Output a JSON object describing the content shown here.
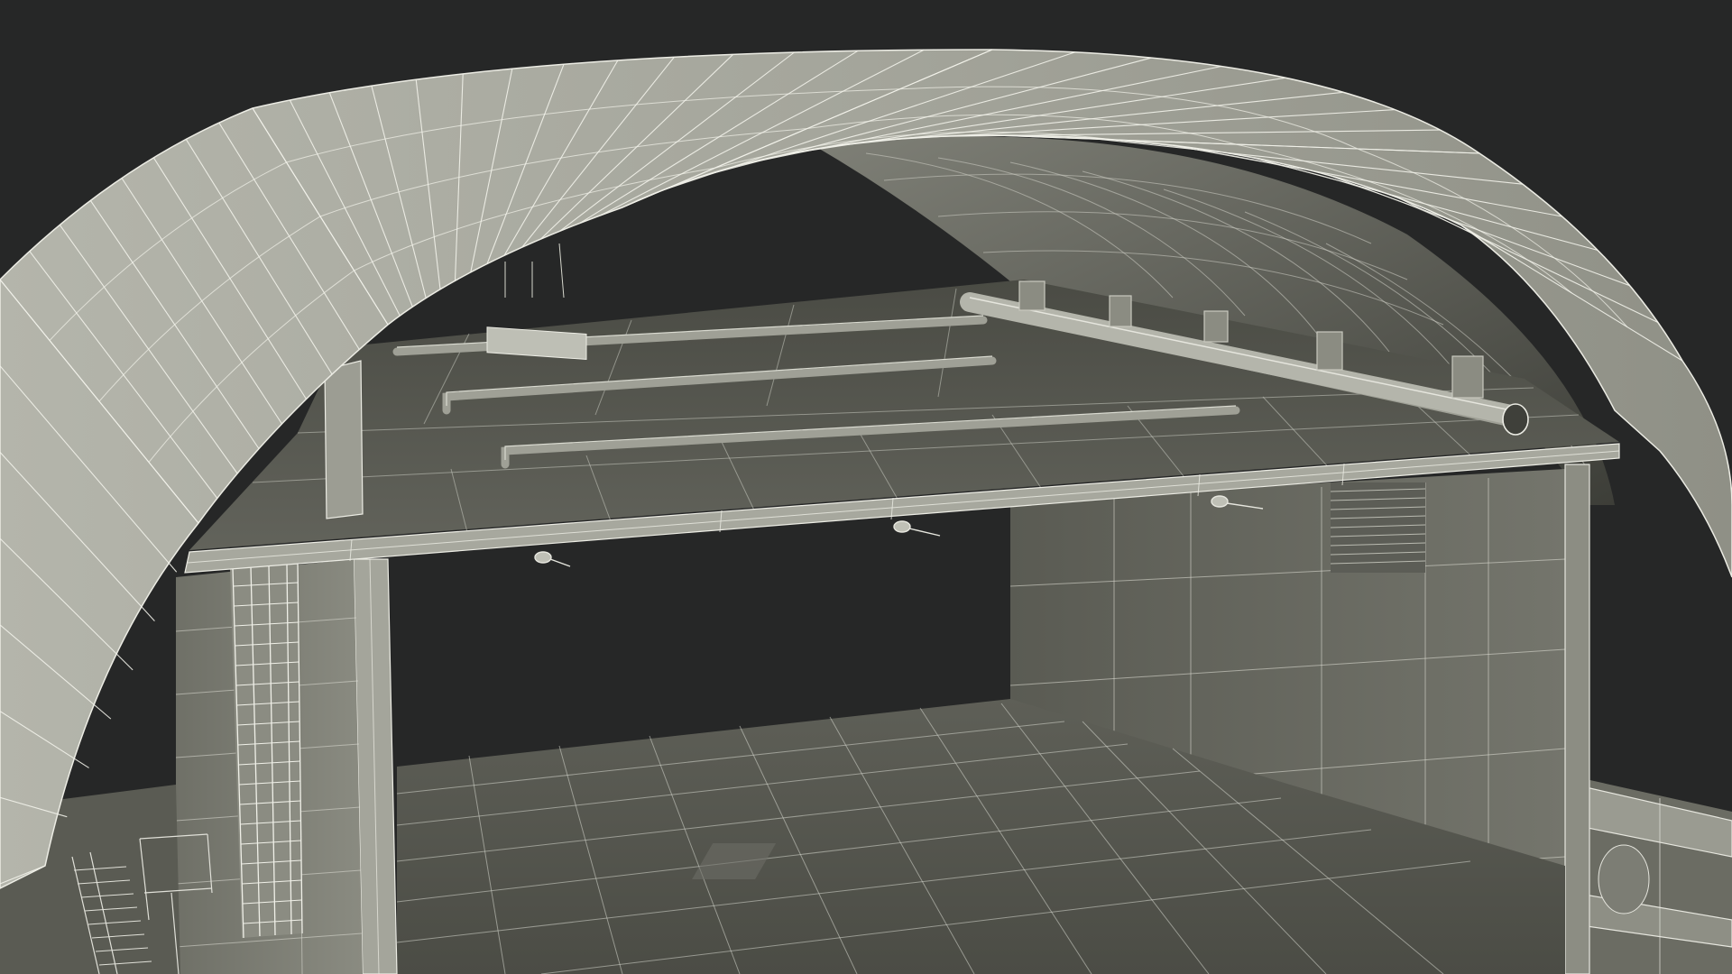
{
  "scene": {
    "subject": "wireframe-render-arched-tunnel-section",
    "colors": {
      "background": "#262727",
      "surface_light": "#a9aaa0",
      "surface_mid": "#808176",
      "surface_dark": "#4c4d46",
      "wire": "#ecece4"
    }
  }
}
